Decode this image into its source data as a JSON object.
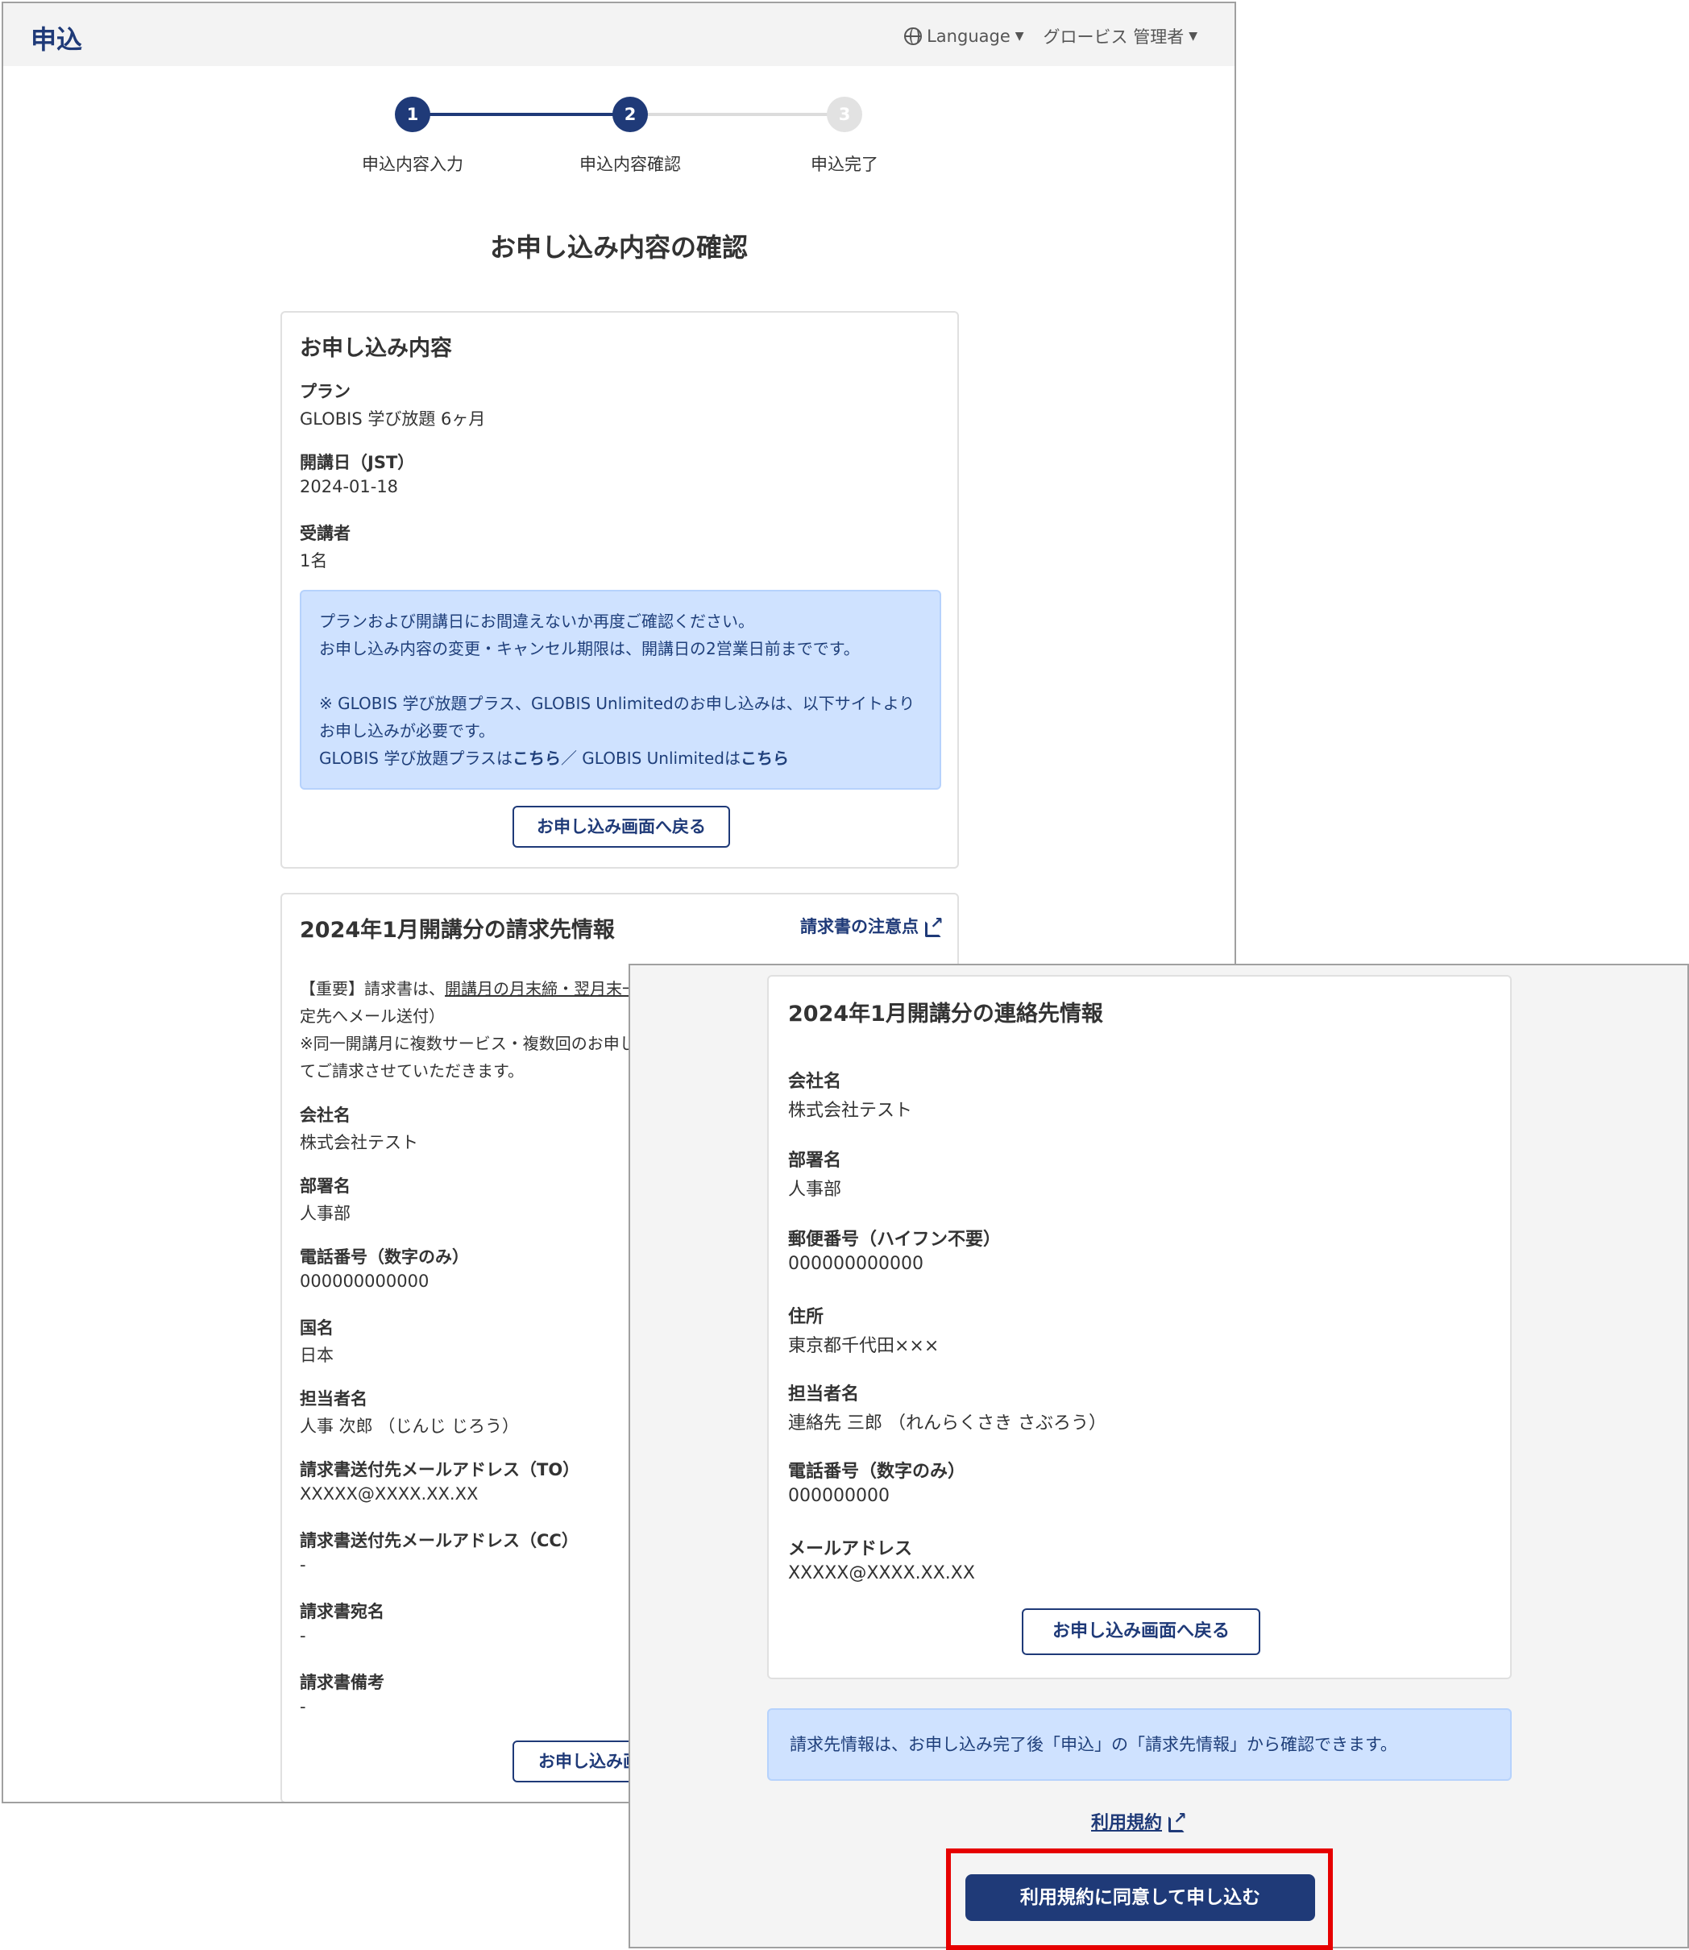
{
  "header": {
    "title": "申込",
    "language_label": "Language",
    "user_label": "グロービス 管理者"
  },
  "stepper": {
    "steps": [
      {
        "number": "1",
        "label": "申込内容入力"
      },
      {
        "number": "2",
        "label": "申込内容確認"
      },
      {
        "number": "3",
        "label": "申込完了"
      }
    ]
  },
  "page_title": "お申し込み内容の確認",
  "application": {
    "title": "お申し込み内容",
    "fields": [
      {
        "label": "プラン",
        "value": "GLOBIS 学び放題 6ヶ月"
      },
      {
        "label": "開講日（JST）",
        "value": "2024-01-18"
      },
      {
        "label": "受講者",
        "value": "1名"
      }
    ],
    "info_line1": "プランおよび開講日にお間違えないか再度ご確認ください。",
    "info_line2": "お申し込み内容の変更・キャンセル期限は、開講日の2営業日前までです。",
    "info_line3": "※ GLOBIS 学び放題プラス、GLOBIS Unlimitedのお申し込みは、以下サイトより",
    "info_line4": "お申し込みが必要です。",
    "info_line5a": "GLOBIS 学び放題プラスは",
    "info_link1": "こちら",
    "info_line5b": "／ GLOBIS Unlimitedは",
    "info_link2": "こちら",
    "back_button": "お申し込み画面へ戻る"
  },
  "billing": {
    "title": "2024年1月開講分の請求先情報",
    "notes_link": "請求書の注意点",
    "notice_line1a": "【重要】請求書は、",
    "notice_line1b": "開講月の月末締・翌月末一",
    "notice_line2": "定先へメール送付）",
    "notice_line3": "※同一開講月に複数サービス・複数回のお申し",
    "notice_line4": "てご請求させていただきます。",
    "fields": [
      {
        "label": "会社名",
        "value": "株式会社テスト"
      },
      {
        "label": "部署名",
        "value": "人事部"
      },
      {
        "label": "電話番号（数字のみ）",
        "value": "000000000000"
      },
      {
        "label": "国名",
        "value": "日本"
      },
      {
        "label": "担当者名",
        "value": "人事 次郎 （じんじ じろう）"
      },
      {
        "label": "請求書送付先メールアドレス（TO）",
        "value": "XXXXX@XXXX.XX.XX"
      },
      {
        "label": "請求書送付先メールアドレス（CC）",
        "value": "-"
      },
      {
        "label": "請求書宛名",
        "value": "-"
      },
      {
        "label": "請求書備考",
        "value": "-"
      }
    ],
    "back_button": "お申し込み画"
  },
  "contact": {
    "title": "2024年1月開講分の連絡先情報",
    "fields": [
      {
        "label": "会社名",
        "value": "株式会社テスト"
      },
      {
        "label": "部署名",
        "value": "人事部"
      },
      {
        "label": "郵便番号（ハイフン不要）",
        "value": "000000000000"
      },
      {
        "label": "住所",
        "value": "東京都千代田×××"
      },
      {
        "label": "担当者名",
        "value": "連絡先 三郎 （れんらくさき さぶろう）"
      },
      {
        "label": "電話番号（数字のみ）",
        "value": "000000000"
      },
      {
        "label": "メールアドレス",
        "value": "XXXXX@XXXX.XX.XX"
      }
    ],
    "back_button": "お申し込み画面へ戻る"
  },
  "footer_info": "請求先情報は、お申し込み完了後「申込」の「請求先情報」から確認できます。",
  "terms_link": "利用規約",
  "submit_button": "利用規約に同意して申し込む",
  "colors": {
    "brand": "#1f3a78",
    "info_bg": "#cfe2ff",
    "highlight": "#e60000"
  }
}
